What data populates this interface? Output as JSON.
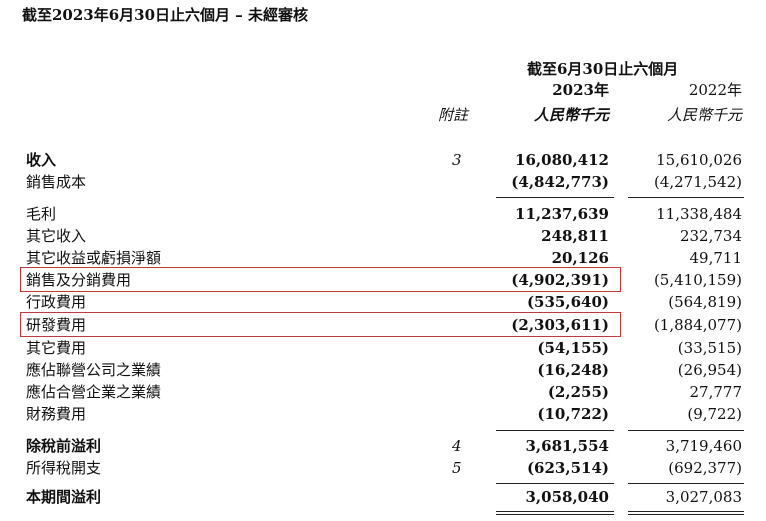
{
  "title": "截至2023年6月30日止六個月 – 未經審核",
  "header": {
    "period": "截至6月30日止六個月",
    "year_current": "2023年",
    "year_prior": "2022年",
    "note_col": "附註",
    "unit_current": "人民幣千元",
    "unit_prior": "人民幣千元"
  },
  "rows": [
    {
      "label": "收入",
      "note": "3",
      "current": "16,080,412",
      "prior": "15,610,026"
    },
    {
      "label": "銷售成本",
      "note": "",
      "current": "(4,842,773)",
      "prior": "(4,271,542)"
    },
    {
      "label": "毛利",
      "note": "",
      "current": "11,237,639",
      "prior": "11,338,484"
    },
    {
      "label": "其它收入",
      "note": "",
      "current": "248,811",
      "prior": "232,734"
    },
    {
      "label": "其它收益或虧損淨額",
      "note": "",
      "current": "20,126",
      "prior": "49,711"
    },
    {
      "label": "銷售及分銷費用",
      "note": "",
      "current": "(4,902,391)",
      "prior": "(5,410,159)"
    },
    {
      "label": "行政費用",
      "note": "",
      "current": "(535,640)",
      "prior": "(564,819)"
    },
    {
      "label": "研發費用",
      "note": "",
      "current": "(2,303,611)",
      "prior": "(1,884,077)"
    },
    {
      "label": "其它費用",
      "note": "",
      "current": "(54,155)",
      "prior": "(33,515)"
    },
    {
      "label": "應佔聯營公司之業績",
      "note": "",
      "current": "(16,248)",
      "prior": "(26,954)"
    },
    {
      "label": "應佔合營企業之業績",
      "note": "",
      "current": "(2,255)",
      "prior": "27,777"
    },
    {
      "label": "財務費用",
      "note": "",
      "current": "(10,722)",
      "prior": "(9,722)"
    },
    {
      "label": "除稅前溢利",
      "note": "4",
      "current": "3,681,554",
      "prior": "3,719,460"
    },
    {
      "label": "所得稅開支",
      "note": "5",
      "current": "(623,514)",
      "prior": "(692,377)"
    },
    {
      "label": "本期間溢利",
      "note": "",
      "current": "3,058,040",
      "prior": "3,027,083"
    }
  ],
  "highlight_color": "#c0393b"
}
